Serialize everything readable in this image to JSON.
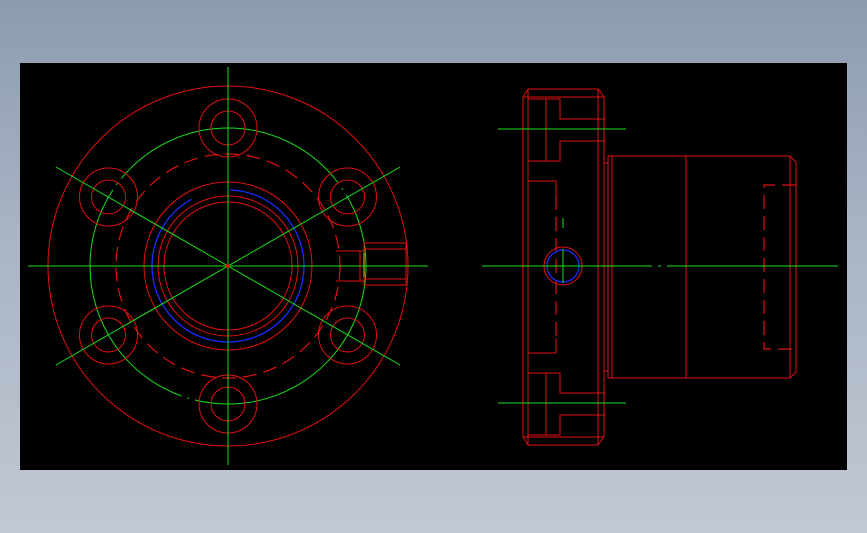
{
  "drawing": {
    "background": "#000000",
    "page_background_top": "#8c9cb0",
    "page_background_bottom": "#c2c8d4",
    "colors": {
      "outline": "#e01010",
      "centerline": "#19e019",
      "thread": "#1a2cff",
      "hidden": "#e01010"
    },
    "views": [
      {
        "name": "front-view",
        "shape": "flange-with-6-bolt-holes"
      },
      {
        "name": "side-view",
        "shape": "flanged-nut-section"
      }
    ]
  }
}
